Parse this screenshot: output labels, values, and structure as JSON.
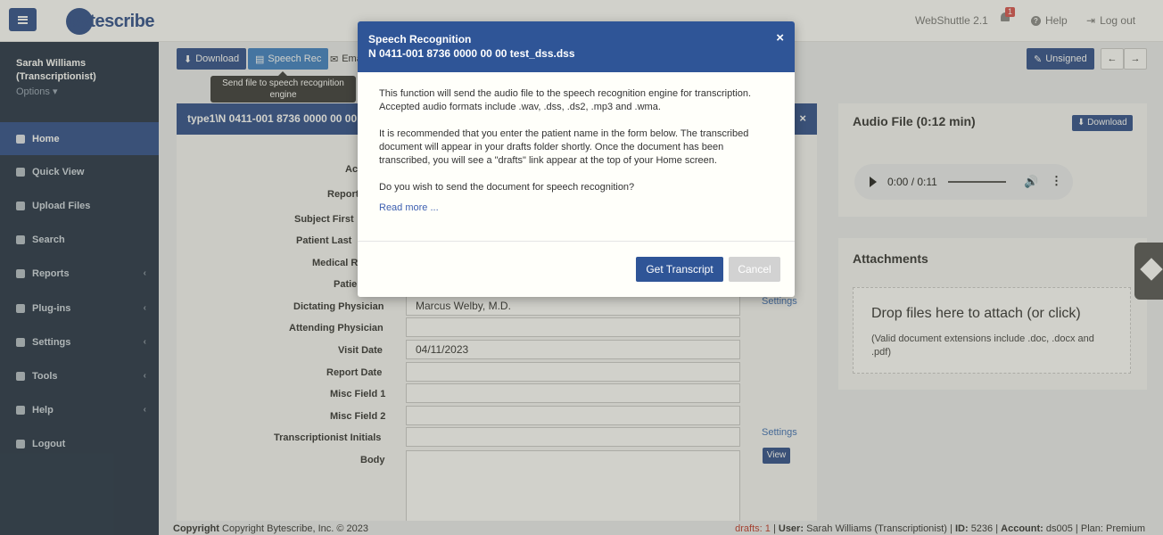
{
  "header": {
    "logo_text": "bytescribe",
    "version": "WebShuttle 2.1",
    "notification_count": "1",
    "help_label": "Help",
    "logout_label": "Log out"
  },
  "sidebar": {
    "user_name": "Sarah Williams",
    "user_role": "(Transcriptionist)",
    "options_label": "Options",
    "items": [
      {
        "label": "Home",
        "icon": "home-icon",
        "active": true
      },
      {
        "label": "Quick View",
        "icon": "file-icon"
      },
      {
        "label": "Upload Files",
        "icon": "upload-icon"
      },
      {
        "label": "Search",
        "icon": "search-icon"
      },
      {
        "label": "Reports",
        "icon": "reports-icon"
      },
      {
        "label": "Plug-ins",
        "icon": "plugins-icon"
      },
      {
        "label": "Settings",
        "icon": "gear-icon"
      },
      {
        "label": "Tools",
        "icon": "wrench-icon"
      },
      {
        "label": "Help",
        "icon": "help-icon"
      },
      {
        "label": "Logout",
        "icon": "logout-icon"
      }
    ]
  },
  "toolbar": {
    "download_label": "Download",
    "speech_rec_label": "Speech Rec",
    "email_label": "Ema",
    "unsigned_label": "Unsigned",
    "tooltip": "Send file to speech recognition engine"
  },
  "form": {
    "panel_title": "type1\\N 0411-001 8736 0000 00 00",
    "labels": {
      "account": "Ac",
      "report": "Report",
      "subject_first": "Subject First",
      "patient_last": "Patient Last",
      "medical": "Medical R",
      "patient": "Patie",
      "dictating_physician": "Dictating Physician",
      "attending_physician": "Attending Physician",
      "visit_date": "Visit Date",
      "report_date": "Report Date",
      "misc1": "Misc Field 1",
      "misc2": "Misc Field 2",
      "transcriptionist_initials": "Transcriptionist Initials",
      "body": "Body"
    },
    "values": {
      "dictating_physician": "Marcus Welby, M.D.",
      "visit_date": "04/11/2023"
    },
    "settings_label": "Settings",
    "view_label": "View"
  },
  "audio": {
    "title": "Audio File (0:12 min)",
    "download_label": "Download",
    "time": "0:00 / 0:11"
  },
  "attachments": {
    "title": "Attachments",
    "drop_text": "Drop files here to attach (or click)",
    "drop_sub": "(Valid document extensions include .doc, .docx and .pdf)"
  },
  "footer": {
    "copyright": "Copyright Bytescribe, Inc. © 2023",
    "drafts": "drafts: 1",
    "user_label": "User:",
    "user_value": "Sarah Williams (Transcriptionist)",
    "id_label": "ID:",
    "id_value": "5236",
    "account_label": "Account:",
    "account_value": "ds005",
    "plan": "Plan: Premium"
  },
  "modal": {
    "title": "Speech Recognition",
    "subtitle": "N 0411-001 8736 0000 00 00 test_dss.dss",
    "para1": "This function will send the audio file to the speech recognition engine for transcription. Accepted audio formats include .wav, .dss, .ds2, .mp3 and .wma.",
    "para2": "It is recommended that you enter the patient name in the form below. The transcribed document will appear in your drafts folder shortly. Once the document has been transcribed, you will see a \"drafts\" link appear at the top of your Home screen.",
    "para3": "Do you wish to send the document for speech recognition?",
    "read_more": "Read more ...",
    "confirm_label": "Get Transcript",
    "cancel_label": "Cancel"
  },
  "colors": {
    "primary": "#2f4e8c",
    "sidebar_bg": "#243347",
    "modal_header": "#2f5597"
  }
}
